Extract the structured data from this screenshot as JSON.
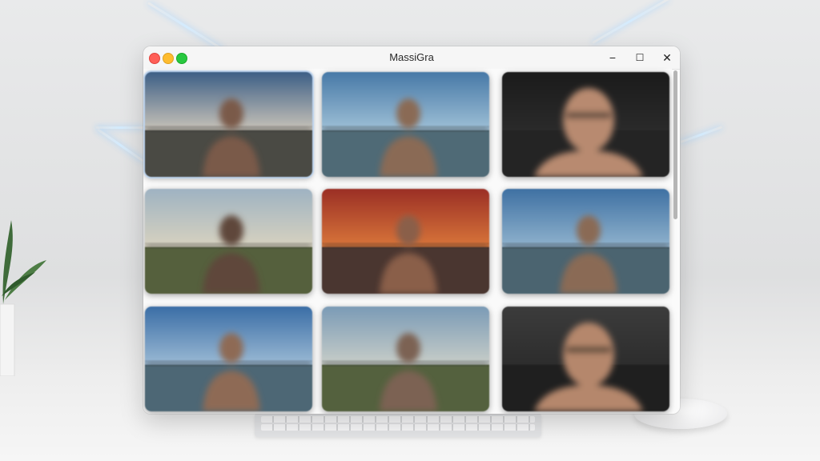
{
  "window": {
    "title": "MassiGra",
    "controls": {
      "minimize": "−",
      "maximize": "☐",
      "close": "✕"
    }
  },
  "thumbnails": [
    {
      "scene": "sunset-sky-man",
      "sky_top": "#3d5f86",
      "sky_bottom": "#c7c2b8",
      "ground": "#4a4a44",
      "subject": "#7a5a48",
      "selected": true
    },
    {
      "scene": "beach-man",
      "sky_top": "#4779a7",
      "sky_bottom": "#9dbfd6",
      "ground": "#4f6a76",
      "subject": "#8a6a55",
      "selected": false
    },
    {
      "scene": "dark-portrait-glasses",
      "sky_top": "#1b1b1b",
      "sky_bottom": "#2a2a2a",
      "ground": "#242424",
      "subject": "#b88a70",
      "selected": false
    },
    {
      "scene": "field-woman",
      "sky_top": "#9fb3c2",
      "sky_bottom": "#d7d2c0",
      "ground": "#55603d",
      "subject": "#5e463a",
      "selected": false
    },
    {
      "scene": "red-sunset-man",
      "sky_top": "#9b2f25",
      "sky_bottom": "#d8753a",
      "ground": "#4a3630",
      "subject": "#8a5e48",
      "selected": false
    },
    {
      "scene": "coast-man",
      "sky_top": "#3f71a3",
      "sky_bottom": "#8fb2cd",
      "ground": "#4b6470",
      "subject": "#8a6a55",
      "selected": false
    },
    {
      "scene": "coast-man-shirtless",
      "sky_top": "#3b6ea6",
      "sky_bottom": "#9ab9d4",
      "ground": "#4d6775",
      "subject": "#8e6a54",
      "selected": false
    },
    {
      "scene": "hill-man",
      "sky_top": "#7b9bb6",
      "sky_bottom": "#c7cdc8",
      "ground": "#54613e",
      "subject": "#7c6252",
      "selected": false
    },
    {
      "scene": "dark-portrait-rocks",
      "sky_top": "#3c3c3c",
      "sky_bottom": "#2d2d2d",
      "ground": "#1f1f1f",
      "subject": "#b5876c",
      "selected": false
    }
  ]
}
